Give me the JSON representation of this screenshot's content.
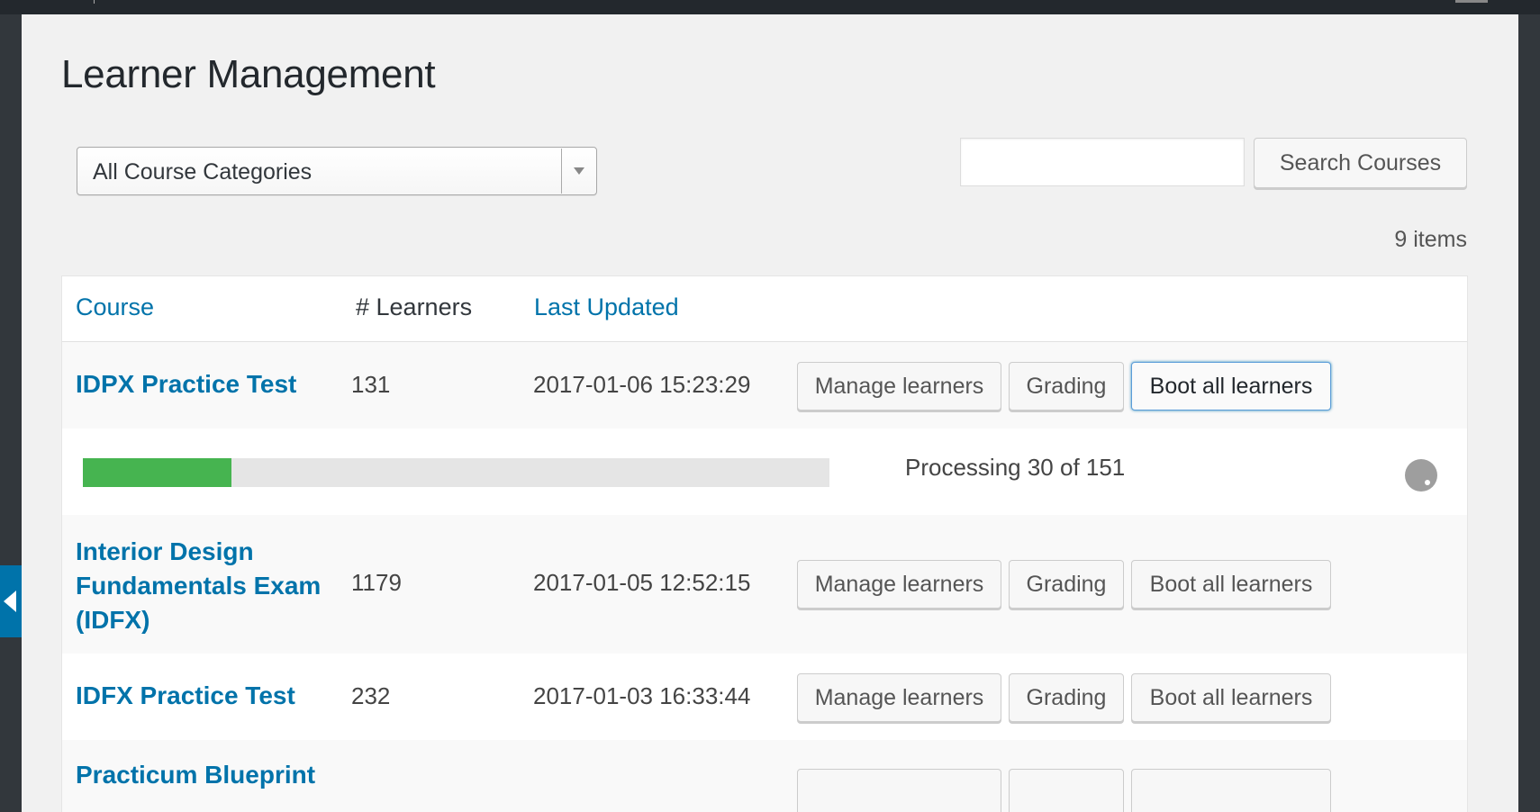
{
  "page": {
    "title": "Learner Management",
    "category_select": {
      "selected": "All Course Categories"
    },
    "search": {
      "value": "",
      "button_label": "Search Courses"
    },
    "items_count": "9 items"
  },
  "table": {
    "columns": [
      "Course",
      "# Learners",
      "Last Updated"
    ],
    "rows": [
      {
        "course": "IDPX Practice Test",
        "learners": "131",
        "last_updated": "2017-01-06 15:23:29",
        "actions": [
          "Manage learners",
          "Grading",
          "Boot all learners"
        ]
      },
      {
        "course": "Interior Design Fundamentals Exam (IDFX)",
        "learners": "1179",
        "last_updated": "2017-01-05 12:52:15",
        "actions": [
          "Manage learners",
          "Grading",
          "Boot all learners"
        ]
      },
      {
        "course": "IDFX Practice Test",
        "learners": "232",
        "last_updated": "2017-01-03 16:33:44",
        "actions": [
          "Manage learners",
          "Grading",
          "Boot all learners"
        ]
      },
      {
        "course": "Practicum Blueprint",
        "learners": "",
        "last_updated": "",
        "actions": [
          "",
          "",
          ""
        ]
      }
    ],
    "processing": {
      "text": "Processing 30 of 151",
      "progress_fraction": 0.199
    }
  },
  "colors": {
    "link": "#0073aa",
    "progress_fill": "#46b450",
    "focus_border": "#5b9dd9"
  }
}
